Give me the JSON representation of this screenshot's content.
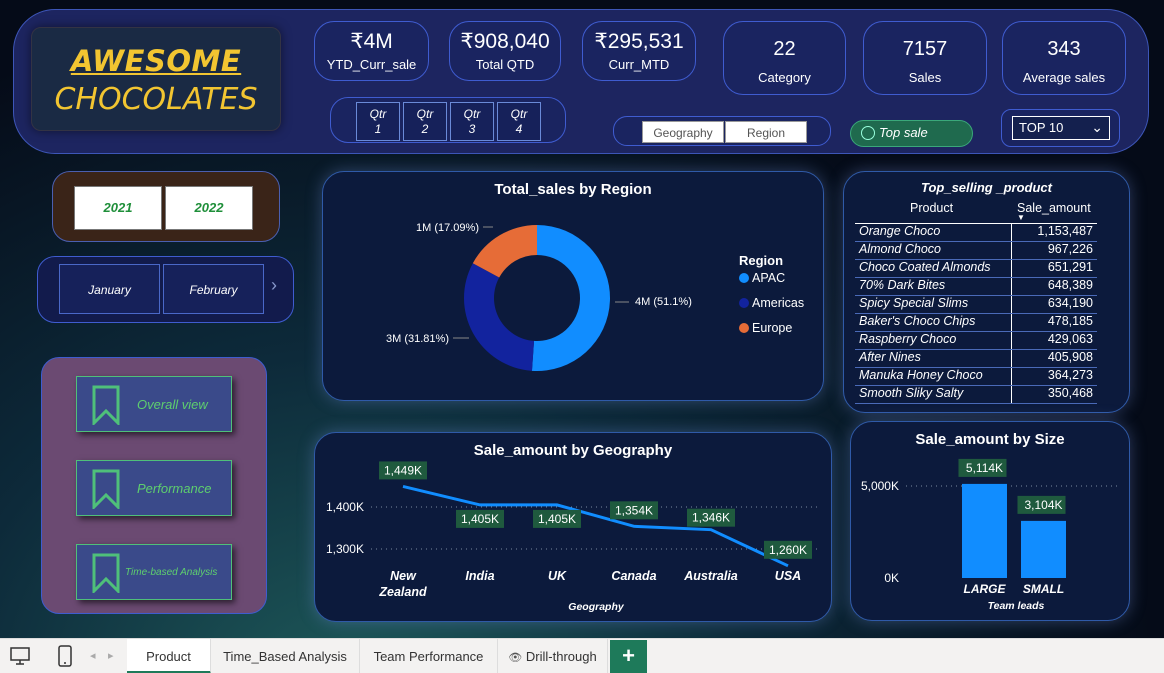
{
  "logo": {
    "line1": "AWESOME",
    "line2": "CHOCOLATES"
  },
  "kpis": [
    {
      "value": "₹4M",
      "label": "YTD_Curr_sale"
    },
    {
      "value": "₹908,040",
      "label": "Total QTD"
    },
    {
      "value": "₹295,531",
      "label": "Curr_MTD"
    },
    {
      "value": "22",
      "label": "Category"
    },
    {
      "value": "7157",
      "label": "Sales"
    },
    {
      "value": "343",
      "label": "Average sales"
    }
  ],
  "quarters": [
    {
      "l1": "Qtr",
      "l2": "1"
    },
    {
      "l1": "Qtr",
      "l2": "2"
    },
    {
      "l1": "Qtr",
      "l2": "3"
    },
    {
      "l1": "Qtr",
      "l2": "4"
    }
  ],
  "geo_slicer": {
    "geography": "Geography",
    "region": "Region"
  },
  "top_sale": "Top sale",
  "top10": "TOP 10",
  "years": [
    "2021",
    "2022"
  ],
  "months": [
    "January",
    "February"
  ],
  "nav": [
    "Overall view",
    "Performance",
    "Time-based Analysis"
  ],
  "donut": {
    "title": "Total_sales by Region",
    "legend_title": "Region",
    "slices": [
      {
        "name": "APAC",
        "pct": 51.1,
        "label": "4M (51.1%)",
        "color": "#118dff"
      },
      {
        "name": "Americas",
        "pct": 31.81,
        "label": "3M (31.81%)",
        "color": "#12239e"
      },
      {
        "name": "Europe",
        "pct": 17.09,
        "label": "1M (17.09%)",
        "color": "#e66c37"
      }
    ]
  },
  "table": {
    "title": "Top_selling _product",
    "headers": [
      "Product",
      "Sale_amount"
    ],
    "rows": [
      [
        "Orange Choco",
        "1,153,487"
      ],
      [
        "Almond Choco",
        "967,226"
      ],
      [
        "Choco Coated Almonds",
        "651,291"
      ],
      [
        "70% Dark Bites",
        "648,389"
      ],
      [
        "Spicy Special Slims",
        "634,190"
      ],
      [
        "Baker's Choco Chips",
        "478,185"
      ],
      [
        "Raspberry Choco",
        "429,063"
      ],
      [
        "After Nines",
        "405,908"
      ],
      [
        "Manuka Honey Choco",
        "364,273"
      ],
      [
        "Smooth Sliky Salty",
        "350,468"
      ]
    ]
  },
  "line_chart": {
    "title": "Sale_amount by Geography",
    "xlabel": "Geography",
    "y_ticks": [
      "1,400K",
      "1,300K"
    ],
    "categories": [
      "New Zealand",
      "India",
      "UK",
      "Canada",
      "Australia",
      "USA"
    ],
    "labels": [
      "1,449K",
      "1,405K",
      "1,405K",
      "1,354K",
      "1,346K",
      "1,260K"
    ]
  },
  "bar_chart": {
    "title": "Sale_amount by Size",
    "xlabel": "Team leads",
    "y_ticks": [
      "5,000K",
      "0K"
    ],
    "categories": [
      "LARGE",
      "SMALL"
    ],
    "labels": [
      "5,114K",
      "3,104K"
    ]
  },
  "chart_data": [
    {
      "type": "pie",
      "title": "Total_sales by Region",
      "categories": [
        "APAC",
        "Americas",
        "Europe"
      ],
      "values": [
        51.1,
        31.81,
        17.09
      ],
      "legend": "right"
    },
    {
      "type": "line",
      "title": "Sale_amount by Geography",
      "xlabel": "Geography",
      "categories": [
        "New Zealand",
        "India",
        "UK",
        "Canada",
        "Australia",
        "USA"
      ],
      "values": [
        1449,
        1405,
        1405,
        1354,
        1346,
        1260
      ],
      "ylim": [
        1230,
        1480
      ]
    },
    {
      "type": "bar",
      "title": "Sale_amount by Size",
      "xlabel": "Team leads",
      "categories": [
        "LARGE",
        "SMALL"
      ],
      "values": [
        5114,
        3104
      ],
      "ylim": [
        0,
        6000
      ]
    }
  ],
  "tabs": [
    "Product",
    "Time_Based Analysis",
    "Team Performance",
    "Drill-through"
  ]
}
